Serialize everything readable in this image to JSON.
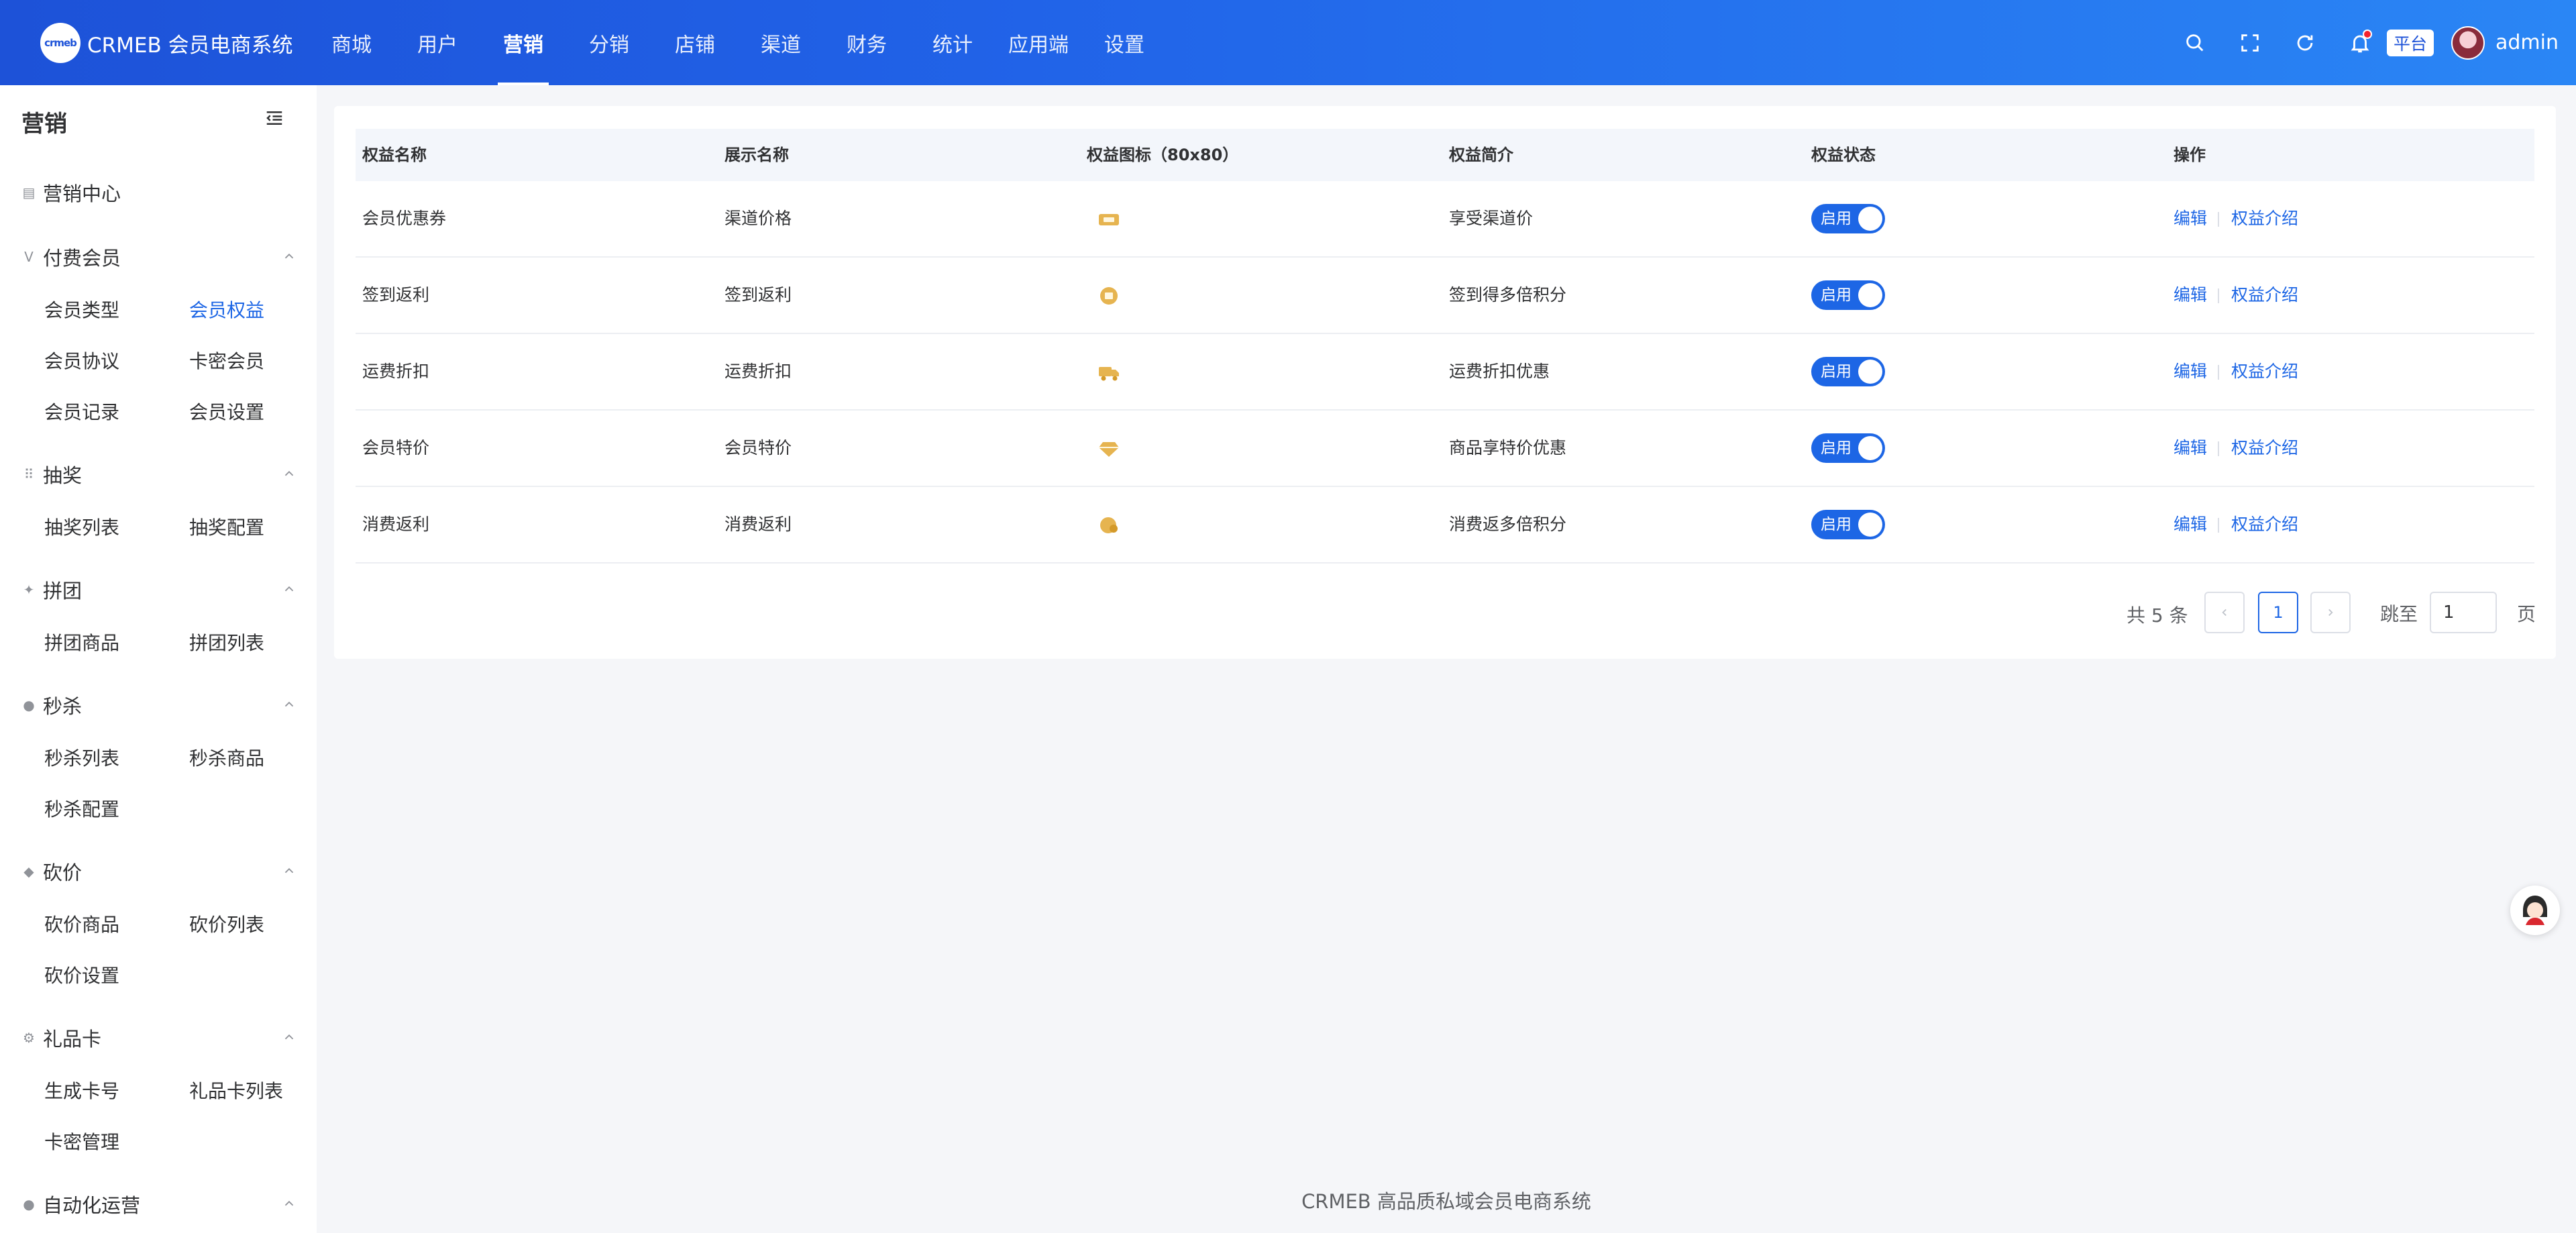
{
  "header": {
    "logo_mark": "crmeb",
    "brand": "CRMEB 会员电商系统",
    "nav": [
      "商城",
      "用户",
      "营销",
      "分销",
      "店铺",
      "渠道",
      "财务",
      "统计",
      "应用端",
      "设置"
    ],
    "active_nav": "营销",
    "platform": "平台",
    "username": "admin",
    "icons": [
      "search-icon",
      "fullscreen-icon",
      "refresh-icon",
      "bell-icon"
    ]
  },
  "sidebar": {
    "title": "营销",
    "center": "营销中心",
    "groups": {
      "paid_member": {
        "title": "付费会员",
        "items": [
          "会员类型",
          "会员权益",
          "会员协议",
          "卡密会员",
          "会员记录",
          "会员设置"
        ],
        "active": "会员权益"
      },
      "lottery": {
        "title": "抽奖",
        "items": [
          "抽奖列表",
          "抽奖配置"
        ]
      },
      "group_buy": {
        "title": "拼团",
        "items": [
          "拼团商品",
          "拼团列表"
        ]
      },
      "seckill": {
        "title": "秒杀",
        "items": [
          "秒杀列表",
          "秒杀商品",
          "秒杀配置"
        ]
      },
      "bargain": {
        "title": "砍价",
        "items": [
          "砍价商品",
          "砍价列表",
          "砍价设置"
        ]
      },
      "gift_card": {
        "title": "礼品卡",
        "items": [
          "生成卡号",
          "礼品卡列表",
          "卡密管理"
        ]
      },
      "automation": {
        "title": "自动化运营"
      }
    }
  },
  "table": {
    "columns": [
      "权益名称",
      "展示名称",
      "权益图标（80x80）",
      "权益简介",
      "权益状态",
      "操作"
    ],
    "rows": [
      {
        "name": "会员优惠券",
        "display": "渠道价格",
        "icon": "coupon-icon",
        "intro": "享受渠道价",
        "status": "启用"
      },
      {
        "name": "签到返利",
        "display": "签到返利",
        "icon": "signin-icon",
        "intro": "签到得多倍积分",
        "status": "启用"
      },
      {
        "name": "运费折扣",
        "display": "运费折扣",
        "icon": "truck-icon",
        "intro": "运费折扣优惠",
        "status": "启用"
      },
      {
        "name": "会员特价",
        "display": "会员特价",
        "icon": "diamond-icon",
        "intro": "商品享特价优惠",
        "status": "启用"
      },
      {
        "name": "消费返利",
        "display": "消费返利",
        "icon": "rebate-icon",
        "intro": "消费返多倍积分",
        "status": "启用"
      }
    ],
    "actions": {
      "edit": "编辑",
      "intro": "权益介绍"
    }
  },
  "pagination": {
    "total": "共 5 条",
    "current": "1",
    "jump_label": "跳至",
    "jump_value": "1",
    "page_suffix": "页"
  },
  "footer": "CRMEB 高品质私域会员电商系统",
  "colors": {
    "primary": "#1d66e5",
    "header_start": "#1d52d8",
    "header_end": "#2a86f5",
    "icon_gold": "#e6b450"
  }
}
